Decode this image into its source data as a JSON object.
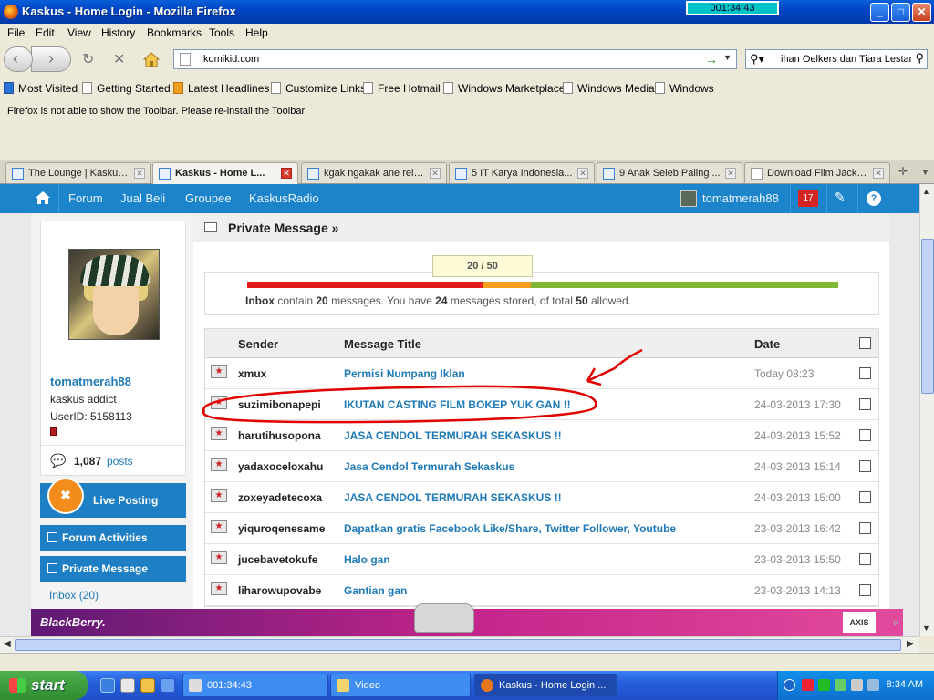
{
  "window": {
    "title": "Kaskus - Home Login - Mozilla Firefox",
    "timer": "001:34:43",
    "minimize": "_",
    "maximize": "□",
    "close": "✕"
  },
  "menu": [
    "File",
    "Edit",
    "View",
    "History",
    "Bookmarks",
    "Tools",
    "Help"
  ],
  "address": {
    "url": "komikid.com",
    "search_value": "ihan Oelkers dan Tiara Lestari"
  },
  "bookmarks": [
    "Most Visited",
    "Getting Started",
    "Latest Headlines",
    "Customize Links",
    "Free Hotmail",
    "Windows Marketplace",
    "Windows Media",
    "Windows"
  ],
  "toolbar_notice": "Firefox is not able to show the Toolbar. Please re-install the Toolbar",
  "tabs": [
    {
      "label": "The Lounge | Kaskus..."
    },
    {
      "label": "Kaskus - Home L..."
    },
    {
      "label": "kgak ngakak ane rela..."
    },
    {
      "label": "5 IT Karya Indonesia..."
    },
    {
      "label": "9 Anak Seleb Paling ..."
    },
    {
      "label": "Download Film Jack t..."
    }
  ],
  "site_nav": {
    "items": [
      "Forum",
      "Jual Beli",
      "Groupee",
      "KaskusRadio"
    ],
    "username": "tomatmerah88",
    "notifications": "17",
    "help": "?"
  },
  "profile": {
    "username": "tomatmerah88",
    "rank": "kaskus addict",
    "user_id": "UserID: 5158113",
    "posts_count": "1,087",
    "posts_label": "posts"
  },
  "sidebar": {
    "live_posting": "Live Posting",
    "forum_activities": "Forum Activities",
    "private_message": "Private Message",
    "inbox": "Inbox (20)"
  },
  "pm": {
    "title": "Private Message »",
    "quota_tip": "20 / 50",
    "quota": {
      "inbox": 20,
      "stored": 24,
      "total": 50
    },
    "quota_text": {
      "inbox_label": "Inbox",
      "t1": " contain ",
      "inbox_count": "20",
      "t2": " messages. You have ",
      "stored": "24",
      "t3": " messages stored, of total ",
      "total": "50",
      "t4": " allowed."
    },
    "columns": {
      "sender": "Sender",
      "title": "Message Title",
      "date": "Date"
    },
    "messages": [
      {
        "sender": "xmux",
        "title": "Permisi Numpang Iklan",
        "date": "Today 08:23"
      },
      {
        "sender": "suzimibonapepi",
        "title": "IKUTAN CASTING FILM BOKEP YUK GAN !!",
        "date": "24-03-2013 17:30"
      },
      {
        "sender": "harutihusopona",
        "title": "JASA CENDOL TERMURAH SEKASKUS !!",
        "date": "24-03-2013 15:52"
      },
      {
        "sender": "yadaxoceloxahu",
        "title": "Jasa Cendol Termurah Sekaskus",
        "date": "24-03-2013 15:14"
      },
      {
        "sender": "zoxeyadetecoxa",
        "title": "JASA CENDOL TERMURAH SEKASKUS !!",
        "date": "24-03-2013 15:00"
      },
      {
        "sender": "yiquroqenesame",
        "title": "Dapatkan gratis Facebook Like/Share, Twitter Follower, Youtube",
        "date": "23-03-2013 16:42"
      },
      {
        "sender": "jucebavetokufe",
        "title": "Halo gan",
        "date": "23-03-2013 15:50"
      },
      {
        "sender": "liharowupovabe",
        "title": "Gantian gan",
        "date": "23-03-2013 14:13"
      }
    ]
  },
  "banner": {
    "brand": "BlackBerry.",
    "partner": "AXIS"
  },
  "taskbar": {
    "start": "start",
    "items": [
      "001:34:43",
      "Video",
      "Kaskus - Home Login ..."
    ],
    "clock": "8:34 AM"
  },
  "colors": {
    "accent": "#1c84cb",
    "annotation": "#e00000",
    "quota_used": "#e21b1b",
    "quota_stored": "#f59d1c",
    "quota_free": "#82b735"
  }
}
